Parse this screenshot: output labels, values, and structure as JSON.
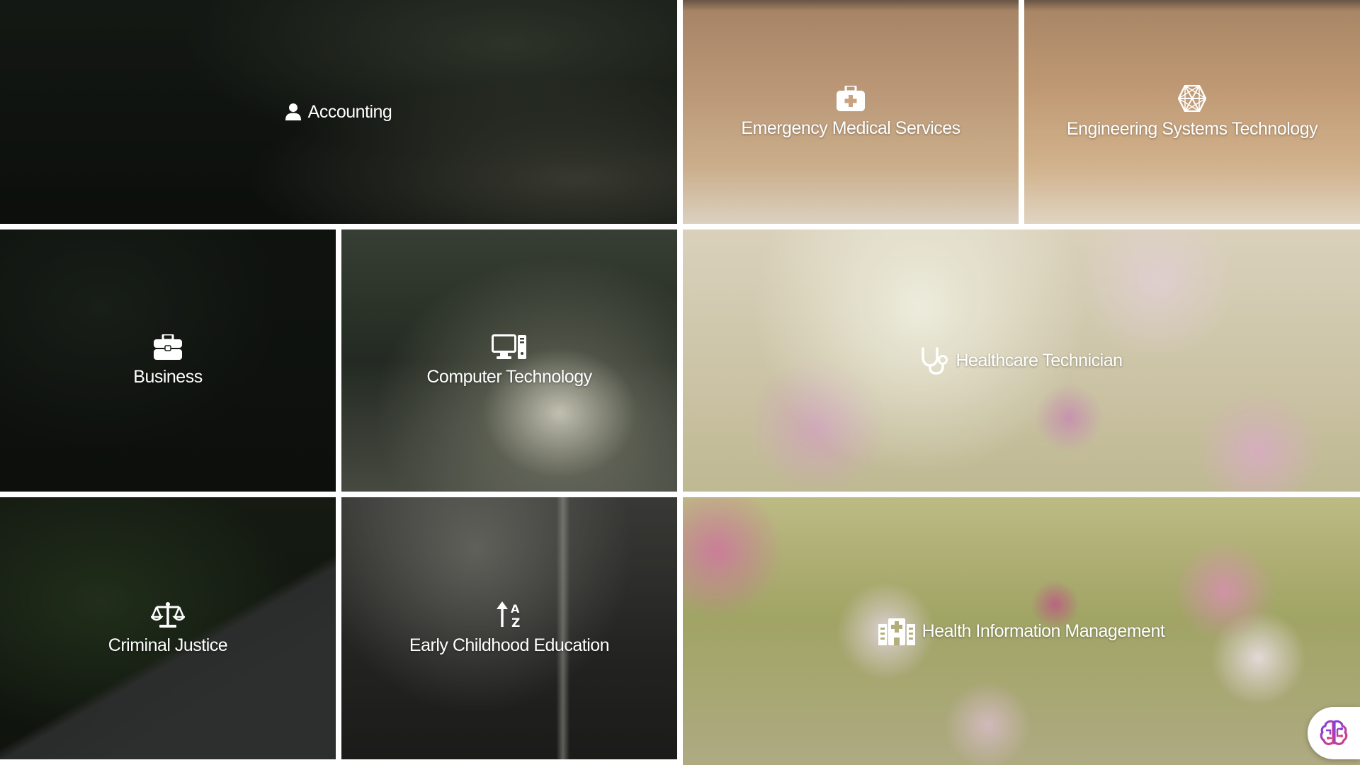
{
  "tiles": [
    {
      "id": "accounting",
      "label": "Accounting",
      "icon": "user-icon"
    },
    {
      "id": "ems",
      "label": "Emergency Medical Services",
      "icon": "first-aid-kit-icon"
    },
    {
      "id": "est",
      "label": "Engineering Systems Technology",
      "icon": "hexagon-network-icon"
    },
    {
      "id": "business",
      "label": "Business",
      "icon": "briefcase-icon"
    },
    {
      "id": "comptech",
      "label": "Computer Technology",
      "icon": "desktop-computer-icon"
    },
    {
      "id": "healthtech",
      "label": "Healthcare Technician",
      "icon": "stethoscope-icon"
    },
    {
      "id": "criminal",
      "label": "Criminal Justice",
      "icon": "balance-scale-icon"
    },
    {
      "id": "early",
      "label": "Early Childhood Education",
      "icon": "sort-alpha-icon"
    },
    {
      "id": "him",
      "label": "Health Information Management",
      "icon": "hospital-records-icon"
    }
  ],
  "assistant": {
    "icon": "brain-icon"
  },
  "colors": {
    "label_text": "#ffffff",
    "grid_gap": "#ffffff",
    "assistant_brain_purple": "#7b3fe4",
    "assistant_brain_pink": "#e0407c"
  }
}
